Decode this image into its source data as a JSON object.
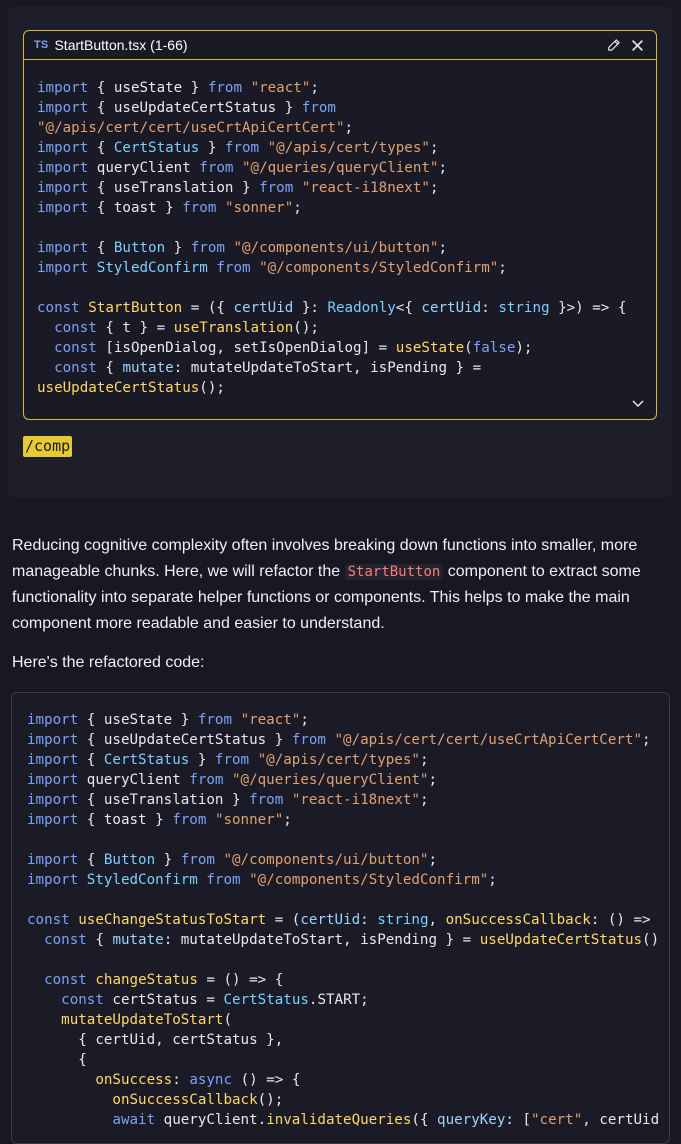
{
  "prompt": {
    "file": {
      "badge": "TS",
      "title": "StartButton.tsx (1-66)",
      "lines": [
        [
          [
            "import",
            "kw"
          ],
          [
            " { useState } ",
            "pl"
          ],
          [
            "from",
            "kw"
          ],
          [
            " ",
            "pl"
          ],
          [
            "\"react\"",
            "str"
          ],
          [
            ";",
            "pl"
          ]
        ],
        [
          [
            "import",
            "kw"
          ],
          [
            " { useUpdateCertStatus } ",
            "pl"
          ],
          [
            "from",
            "kw"
          ]
        ],
        [
          [
            "\"@/apis/cert/cert/useCrtApiCertCert\"",
            "str"
          ],
          [
            ";",
            "pl"
          ]
        ],
        [
          [
            "import",
            "kw"
          ],
          [
            " { ",
            "pl"
          ],
          [
            "CertStatus",
            "ty"
          ],
          [
            " } ",
            "pl"
          ],
          [
            "from",
            "kw"
          ],
          [
            " ",
            "pl"
          ],
          [
            "\"@/apis/cert/types\"",
            "str"
          ],
          [
            ";",
            "pl"
          ]
        ],
        [
          [
            "import",
            "kw"
          ],
          [
            " queryClient ",
            "pl"
          ],
          [
            "from",
            "kw"
          ],
          [
            " ",
            "pl"
          ],
          [
            "\"@/queries/queryClient\"",
            "str"
          ],
          [
            ";",
            "pl"
          ]
        ],
        [
          [
            "import",
            "kw"
          ],
          [
            " { useTranslation } ",
            "pl"
          ],
          [
            "from",
            "kw"
          ],
          [
            " ",
            "pl"
          ],
          [
            "\"react-i18next\"",
            "str"
          ],
          [
            ";",
            "pl"
          ]
        ],
        [
          [
            "import",
            "kw"
          ],
          [
            " { toast } ",
            "pl"
          ],
          [
            "from",
            "kw"
          ],
          [
            " ",
            "pl"
          ],
          [
            "\"sonner\"",
            "str"
          ],
          [
            ";",
            "pl"
          ]
        ],
        [
          [
            "",
            "pl"
          ]
        ],
        [
          [
            "import",
            "kw"
          ],
          [
            " { ",
            "pl"
          ],
          [
            "Button",
            "ty"
          ],
          [
            " } ",
            "pl"
          ],
          [
            "from",
            "kw"
          ],
          [
            " ",
            "pl"
          ],
          [
            "\"@/components/ui/button\"",
            "str"
          ],
          [
            ";",
            "pl"
          ]
        ],
        [
          [
            "import",
            "kw"
          ],
          [
            " ",
            "pl"
          ],
          [
            "StyledConfirm",
            "ty"
          ],
          [
            " ",
            "pl"
          ],
          [
            "from",
            "kw"
          ],
          [
            " ",
            "pl"
          ],
          [
            "\"@/components/StyledConfirm\"",
            "str"
          ],
          [
            ";",
            "pl"
          ]
        ],
        [
          [
            "",
            "pl"
          ]
        ],
        [
          [
            "const",
            "kw"
          ],
          [
            " ",
            "pl"
          ],
          [
            "StartButton",
            "fn"
          ],
          [
            " = ({ ",
            "pl"
          ],
          [
            "certUid",
            "pr"
          ],
          [
            " }: ",
            "pl"
          ],
          [
            "Readonly",
            "ty"
          ],
          [
            "<{ ",
            "pl"
          ],
          [
            "certUid",
            "pr"
          ],
          [
            ": ",
            "pl"
          ],
          [
            "string",
            "ty"
          ],
          [
            " }>) => {",
            "pl"
          ]
        ],
        [
          [
            "  ",
            "pl"
          ],
          [
            "const",
            "kw"
          ],
          [
            " { t } = ",
            "pl"
          ],
          [
            "useTranslation",
            "fn"
          ],
          [
            "();",
            "pl"
          ]
        ],
        [
          [
            "  ",
            "pl"
          ],
          [
            "const",
            "kw"
          ],
          [
            " [isOpenDialog, setIsOpenDialog] = ",
            "pl"
          ],
          [
            "useState",
            "fn"
          ],
          [
            "(",
            "pl"
          ],
          [
            "false",
            "kw"
          ],
          [
            ");",
            "pl"
          ]
        ],
        [
          [
            "  ",
            "pl"
          ],
          [
            "const",
            "kw"
          ],
          [
            " { ",
            "pl"
          ],
          [
            "mutate",
            "pr"
          ],
          [
            ": mutateUpdateToStart, isPending } =",
            "pl"
          ]
        ],
        [
          [
            "useUpdateCertStatus",
            "fn"
          ],
          [
            "();",
            "pl"
          ]
        ]
      ]
    },
    "tag": "/comp"
  },
  "response": {
    "para1_before": "Reducing cognitive complexity often involves breaking down functions into smaller, more manageable chunks. Here, we will refactor the ",
    "para1_code": "StartButton",
    "para1_after": " component to extract some functionality into separate helper functions or components. This helps to make the main component more readable and easier to understand.",
    "para2": "Here's the refactored code:",
    "code_lines": [
      [
        [
          "import",
          "kw"
        ],
        [
          " { useState } ",
          "pl"
        ],
        [
          "from",
          "kw"
        ],
        [
          " ",
          "pl"
        ],
        [
          "\"react\"",
          "str"
        ],
        [
          ";",
          "pl"
        ]
      ],
      [
        [
          "import",
          "kw"
        ],
        [
          " { useUpdateCertStatus } ",
          "pl"
        ],
        [
          "from",
          "kw"
        ],
        [
          " ",
          "pl"
        ],
        [
          "\"@/apis/cert/cert/useCrtApiCertCert\"",
          "str"
        ],
        [
          ";",
          "pl"
        ]
      ],
      [
        [
          "import",
          "kw"
        ],
        [
          " { ",
          "pl"
        ],
        [
          "CertStatus",
          "ty"
        ],
        [
          " } ",
          "pl"
        ],
        [
          "from",
          "kw"
        ],
        [
          " ",
          "pl"
        ],
        [
          "\"@/apis/cert/types\"",
          "str"
        ],
        [
          ";",
          "pl"
        ]
      ],
      [
        [
          "import",
          "kw"
        ],
        [
          " queryClient ",
          "pl"
        ],
        [
          "from",
          "kw"
        ],
        [
          " ",
          "pl"
        ],
        [
          "\"@/queries/queryClient\"",
          "str"
        ],
        [
          ";",
          "pl"
        ]
      ],
      [
        [
          "import",
          "kw"
        ],
        [
          " { useTranslation } ",
          "pl"
        ],
        [
          "from",
          "kw"
        ],
        [
          " ",
          "pl"
        ],
        [
          "\"react-i18next\"",
          "str"
        ],
        [
          ";",
          "pl"
        ]
      ],
      [
        [
          "import",
          "kw"
        ],
        [
          " { toast } ",
          "pl"
        ],
        [
          "from",
          "kw"
        ],
        [
          " ",
          "pl"
        ],
        [
          "\"sonner\"",
          "str"
        ],
        [
          ";",
          "pl"
        ]
      ],
      [
        [
          "",
          "pl"
        ]
      ],
      [
        [
          "import",
          "kw"
        ],
        [
          " { ",
          "pl"
        ],
        [
          "Button",
          "ty"
        ],
        [
          " } ",
          "pl"
        ],
        [
          "from",
          "kw"
        ],
        [
          " ",
          "pl"
        ],
        [
          "\"@/components/ui/button\"",
          "str"
        ],
        [
          ";",
          "pl"
        ]
      ],
      [
        [
          "import",
          "kw"
        ],
        [
          " ",
          "pl"
        ],
        [
          "StyledConfirm",
          "ty"
        ],
        [
          " ",
          "pl"
        ],
        [
          "from",
          "kw"
        ],
        [
          " ",
          "pl"
        ],
        [
          "\"@/components/StyledConfirm\"",
          "str"
        ],
        [
          ";",
          "pl"
        ]
      ],
      [
        [
          "",
          "pl"
        ]
      ],
      [
        [
          "const",
          "kw"
        ],
        [
          " ",
          "pl"
        ],
        [
          "useChangeStatusToStart",
          "fn"
        ],
        [
          " = (",
          "pl"
        ],
        [
          "certUid",
          "pr"
        ],
        [
          ": ",
          "pl"
        ],
        [
          "string",
          "ty"
        ],
        [
          ", ",
          "pl"
        ],
        [
          "onSuccessCallback",
          "fn"
        ],
        [
          ": () =>",
          "pl"
        ]
      ],
      [
        [
          "  ",
          "pl"
        ],
        [
          "const",
          "kw"
        ],
        [
          " { ",
          "pl"
        ],
        [
          "mutate",
          "pr"
        ],
        [
          ": mutateUpdateToStart, isPending } = ",
          "pl"
        ],
        [
          "useUpdateCertStatus",
          "fn"
        ],
        [
          "()",
          "pl"
        ]
      ],
      [
        [
          "",
          "pl"
        ]
      ],
      [
        [
          "  ",
          "pl"
        ],
        [
          "const",
          "kw"
        ],
        [
          " ",
          "pl"
        ],
        [
          "changeStatus",
          "fn"
        ],
        [
          " = () => {",
          "pl"
        ]
      ],
      [
        [
          "    ",
          "pl"
        ],
        [
          "const",
          "kw"
        ],
        [
          " certStatus = ",
          "pl"
        ],
        [
          "CertStatus",
          "ty"
        ],
        [
          ".START;",
          "pl"
        ]
      ],
      [
        [
          "    ",
          "pl"
        ],
        [
          "mutateUpdateToStart",
          "fn"
        ],
        [
          "(",
          "pl"
        ]
      ],
      [
        [
          "      { certUid, certStatus },",
          "pl"
        ]
      ],
      [
        [
          "      {",
          "pl"
        ]
      ],
      [
        [
          "        ",
          "pl"
        ],
        [
          "onSuccess",
          "fn"
        ],
        [
          ": ",
          "pl"
        ],
        [
          "async",
          "kw"
        ],
        [
          " () => {",
          "pl"
        ]
      ],
      [
        [
          "          ",
          "pl"
        ],
        [
          "onSuccessCallback",
          "fn"
        ],
        [
          "();",
          "pl"
        ]
      ],
      [
        [
          "          ",
          "pl"
        ],
        [
          "await",
          "kw"
        ],
        [
          " queryClient.",
          "pl"
        ],
        [
          "invalidateQueries",
          "fn"
        ],
        [
          "({ ",
          "pl"
        ],
        [
          "queryKey",
          "pr"
        ],
        [
          ": [",
          "pl"
        ],
        [
          "\"cert\"",
          "str"
        ],
        [
          ", certUid",
          "pl"
        ]
      ]
    ]
  }
}
